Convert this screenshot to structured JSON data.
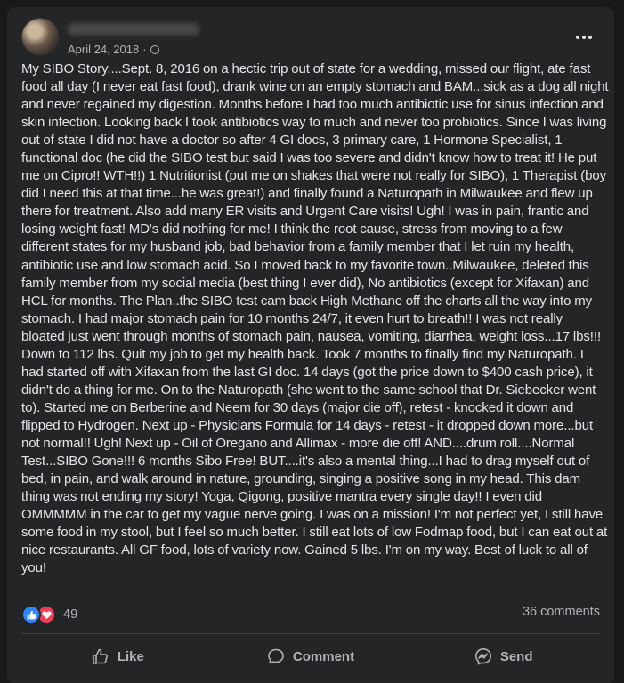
{
  "post": {
    "date": "April 24, 2018",
    "privacy_icon": "globe-icon",
    "more_icon": "more-options-icon",
    "text": "My SIBO Story....Sept. 8, 2016 on a hectic trip out of state for a wedding, missed our flight, ate fast food all day (I never eat fast food), drank wine on an empty stomach and BAM...sick as a dog all night and never regained my digestion.  Months before I had too much antibiotic use for sinus infection and skin infection. Looking back I took antibiotics way to much and never too probiotics.  Since I was living out of state I did not have a doctor so after 4 GI docs, 3 primary care, 1 Hormone Specialist, 1 functional doc (he did the SIBO test but said I was too severe and didn't know how to treat it! He put me on Cipro!! WTH!!) 1 Nutritionist (put me on shakes that were not really for SIBO), 1 Therapist (boy did I need this at that time...he was great!) and finally found a Naturopath in Milwaukee and flew up there for treatment.  Also add many ER visits and Urgent Care visits! Ugh!  I was in pain, frantic and losing weight fast!  MD's did nothing for me! I think the root cause, stress from moving to a few different states for my husband job, bad behavior from a family member that I let ruin my health, antibiotic use and low stomach acid.  So I moved back to my favorite town..Milwaukee, deleted this family member from my social media (best thing I ever did), No antibiotics (except for Xifaxan) and HCL for months.  The Plan..the SIBO test cam back High Methane off the charts all the way into my stomach. I had major stomach pain for 10 months 24/7, it even hurt to breath!! I was not really bloated just went through months of stomach pain, nausea, vomiting, diarrhea, weight loss...17 lbs!!! Down to 112 lbs.  Quit my job to get my health back.  Took 7 months to finally find my Naturopath.  I had started off with Xifaxan from the last GI doc. 14 days (got the price down to $400 cash price), it didn't do a thing for me. On to the Naturopath (she went to the same school that Dr. Siebecker went to). Started me on Berberine and Neem for 30 days (major die off), retest - knocked it down and flipped to Hydrogen. Next up - Physicians Formula for 14 days - retest - it dropped down more...but not normal!! Ugh!  Next up - Oil of Oregano and Allimax - more die off! AND....drum roll....Normal Test...SIBO Gone!!! 6 months Sibo Free! BUT....it's also a mental thing...I had to drag myself out of bed, in pain, and walk around in nature, grounding, singing a positive song in my head. This dam thing was not ending my story!  Yoga, Qigong, positive mantra every single day!! I even did OMMMMM in the car to get my vague nerve going.  I was on a mission! I'm not perfect yet, I still have some food in my stool, but I feel so much better.  I still eat lots of low Fodmap food, but I can eat out at nice restaurants.  All GF food, lots of variety now. Gained 5 lbs.  I'm on my way.  Best of luck to all of you!"
  },
  "stats": {
    "reaction_count": "49",
    "comments_label": "36 comments",
    "reaction_icons": [
      "like-reaction-icon",
      "love-reaction-icon"
    ]
  },
  "actions": {
    "like_label": "Like",
    "comment_label": "Comment",
    "share_label": "Send",
    "like_icon": "thumbs-up-icon",
    "comment_icon": "speech-bubble-icon",
    "share_icon": "messenger-icon"
  },
  "colors": {
    "background": "#18191a",
    "card": "#242526",
    "text_primary": "#e4e6eb",
    "text_secondary": "#b0b3b8",
    "like_blue": "#2d88ff",
    "love_red": "#f33e58"
  }
}
